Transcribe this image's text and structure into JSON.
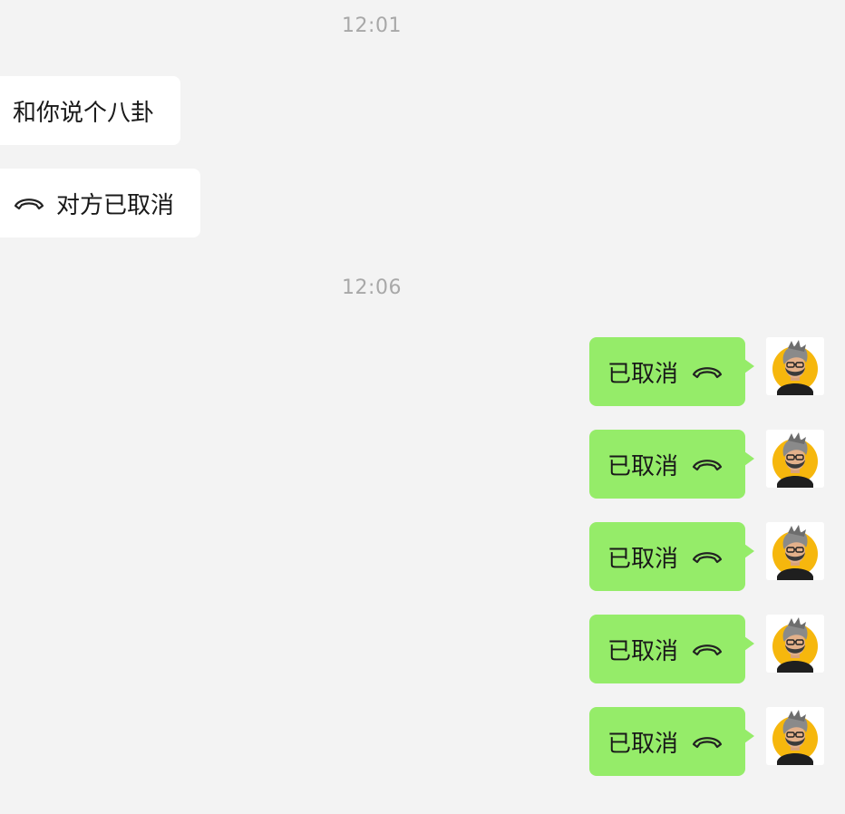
{
  "chat": {
    "timestamps": [
      "12:01",
      "12:06"
    ],
    "incoming": [
      {
        "text": "和你说个八卦",
        "icon": null
      },
      {
        "text": "对方已取消",
        "icon": "phone-hangup-icon"
      }
    ],
    "outgoing": [
      {
        "text": "已取消",
        "icon": "phone-hangup-icon"
      },
      {
        "text": "已取消",
        "icon": "phone-hangup-icon"
      },
      {
        "text": "已取消",
        "icon": "phone-hangup-icon"
      },
      {
        "text": "已取消",
        "icon": "phone-hangup-icon"
      },
      {
        "text": "已取消",
        "icon": "phone-hangup-icon"
      }
    ]
  },
  "colors": {
    "background": "#f3f3f3",
    "incoming_bubble": "#ffffff",
    "outgoing_bubble": "#95ec69",
    "timestamp": "#a8a8a8",
    "avatar_accent": "#f6b70d"
  }
}
